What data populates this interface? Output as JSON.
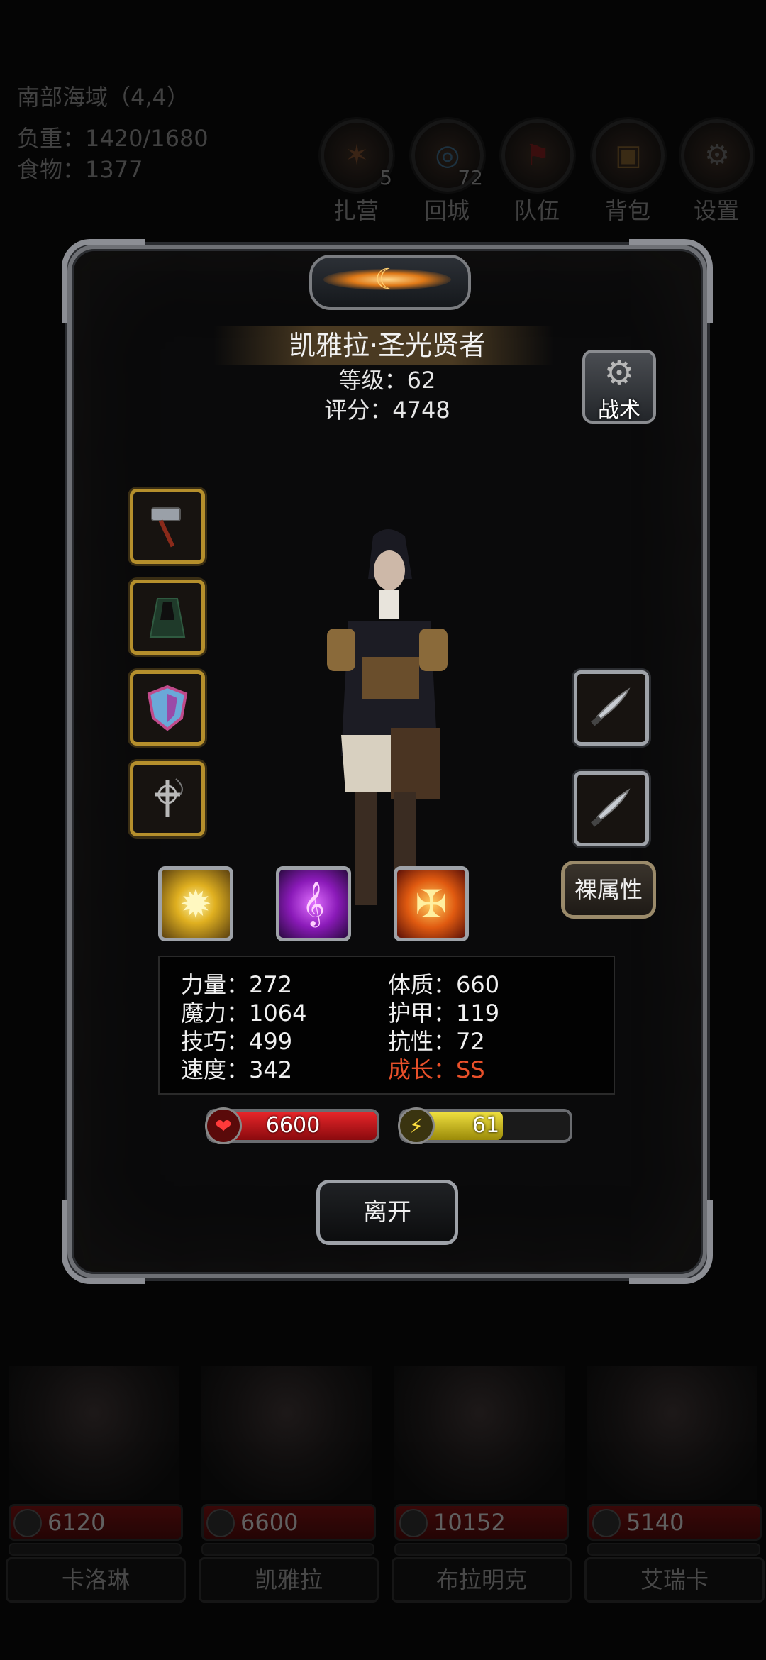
{
  "hud": {
    "location": "南部海域（4,4）",
    "weight": "负重：1420/1680",
    "food": "食物：1377"
  },
  "topbar": [
    {
      "label": "扎营",
      "badge": "5",
      "icon": "campfire-icon"
    },
    {
      "label": "回城",
      "badge": "72",
      "icon": "portal-icon"
    },
    {
      "label": "队伍",
      "badge": "",
      "icon": "team-icon"
    },
    {
      "label": "背包",
      "badge": "",
      "icon": "backpack-icon"
    },
    {
      "label": "设置",
      "badge": "",
      "icon": "gear-icon"
    }
  ],
  "dialog": {
    "title": "凯雅拉·圣光贤者",
    "level": "等级：62",
    "score": "评分：4748",
    "tactics_label": "战术",
    "naked_label": "裸属性",
    "equipment_left": [
      "hammer-icon",
      "cloak-icon",
      "shield-icon",
      "cross-necklace-icon"
    ],
    "equipment_right": [
      "dagger-icon",
      "dagger-icon"
    ],
    "skills": [
      "light-burst-icon",
      "purple-rune-icon",
      "holy-shield-icon"
    ],
    "stats": {
      "str": "力量：272",
      "con": "体质：660",
      "mag": "魔力：1064",
      "armor": "护甲：119",
      "skill": "技巧：499",
      "resist": "抗性：72",
      "speed": "速度：342",
      "growth": "成长：SS"
    },
    "hp_value": "6600",
    "energy_value": "61",
    "energy_fill": 0.6,
    "leave_label": "离开",
    "colors": {
      "accent_gold": "#b58f2c",
      "hp_red": "#c0151a",
      "energy_yellow": "#d8c21a",
      "growth_red": "#e8502a"
    }
  },
  "roster": [
    {
      "name": "卡洛琳",
      "hp": "6120"
    },
    {
      "name": "凯雅拉",
      "hp": "6600"
    },
    {
      "name": "布拉明克",
      "hp": "10152"
    },
    {
      "name": "艾瑞卡",
      "hp": "5140"
    }
  ]
}
